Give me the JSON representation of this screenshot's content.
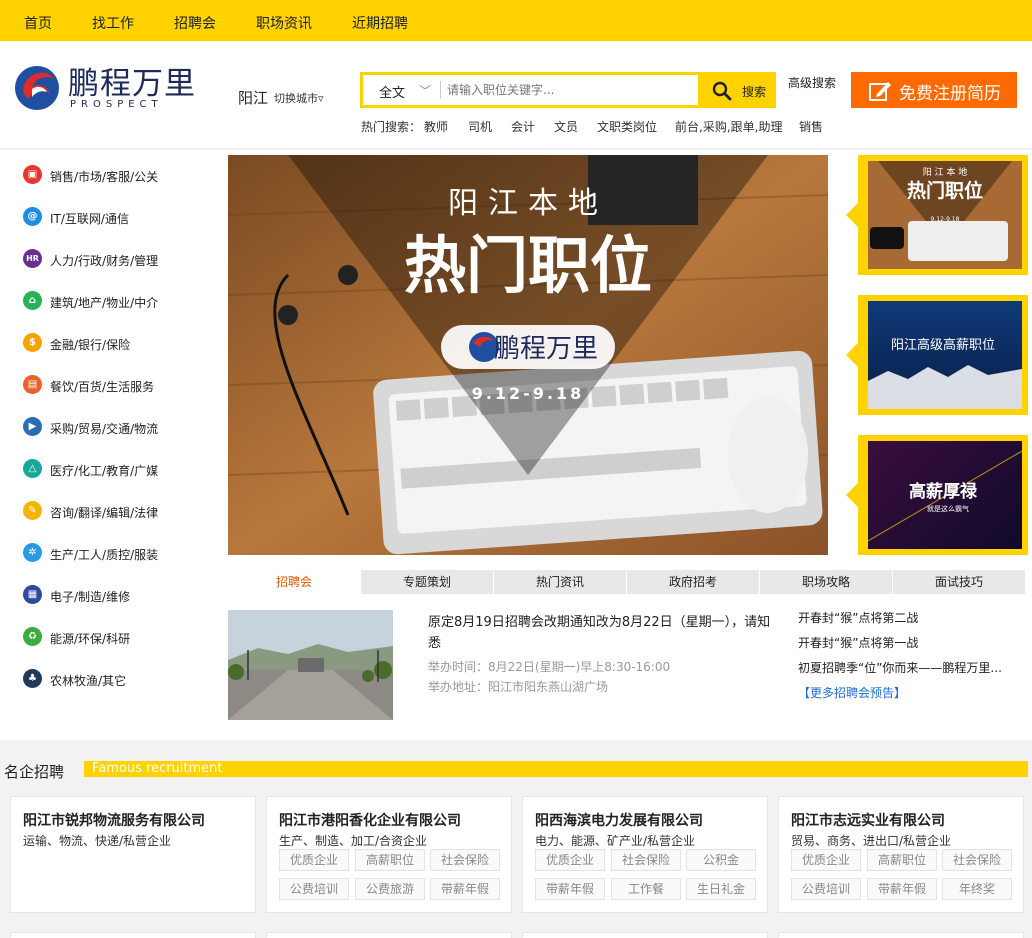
{
  "topnav": {
    "items": [
      "首页",
      "找工作",
      "招聘会",
      "职场资讯",
      "近期招聘"
    ]
  },
  "logo": {
    "cn": "鹏程万里",
    "en": "PROSPECT"
  },
  "city": {
    "name": "阳江",
    "switch_label": "切换城市▿"
  },
  "search": {
    "type": "全文",
    "placeholder": "请输入职位关键字...",
    "button_label": "搜索",
    "advanced_label": "高级搜索"
  },
  "register": {
    "label": "免费注册简历"
  },
  "hot": {
    "label": "热门搜索：",
    "keywords": [
      "教师",
      "司机",
      "会计",
      "文员",
      "文职类岗位",
      "前台,采购,跟单,助理",
      "销售"
    ]
  },
  "categories": [
    {
      "label": "销售/市场/客服/公关",
      "icon": "shopping-bag-icon",
      "color": "#e8352e"
    },
    {
      "label": "IT/互联网/通信",
      "icon": "at-icon",
      "color": "#1e8ee0"
    },
    {
      "label": "人力/行政/财务/管理",
      "icon": "hr-icon",
      "color": "#6a2f8f"
    },
    {
      "label": "建筑/地产/物业/中介",
      "icon": "house-icon",
      "color": "#2bb05a"
    },
    {
      "label": "金融/银行/保险",
      "icon": "dollar-icon",
      "color": "#f4a300"
    },
    {
      "label": "餐饮/百货/生活服务",
      "icon": "cart-icon",
      "color": "#e8622b"
    },
    {
      "label": "采购/贸易/交通/物流",
      "icon": "truck-icon",
      "color": "#2a6fb3"
    },
    {
      "label": "医疗/化工/教育/广媒",
      "icon": "flask-icon",
      "color": "#18a89a"
    },
    {
      "label": "咨询/翻译/编辑/法律",
      "icon": "edit-icon",
      "color": "#f2b600"
    },
    {
      "label": "生产/工人/质控/服装",
      "icon": "gear-icon",
      "color": "#2a9be0"
    },
    {
      "label": "电子/制造/维修",
      "icon": "chip-icon",
      "color": "#2d4aa0"
    },
    {
      "label": "能源/环保/科研",
      "icon": "recycle-icon",
      "color": "#3dab3d"
    },
    {
      "label": "农林牧渔/其它",
      "icon": "tree-icon",
      "color": "#1f3a5a"
    }
  ],
  "banner": {
    "line1": "阳江本地",
    "line2": "热门职位",
    "brand": "鹏程万里",
    "date": "9.12-9.18"
  },
  "thumbs": [
    {
      "top": "阳 江 本 地",
      "main": "热门职位",
      "date": "9.12-9.18"
    },
    {
      "main": "阳江高级高薪职位"
    },
    {
      "main": "高薪厚禄",
      "sub": "就是这么霸气"
    }
  ],
  "tabs": [
    "招聘会",
    "专题策划",
    "热门资讯",
    "政府招考",
    "职场攻略",
    "面试技巧"
  ],
  "news": {
    "title": "原定8月19日招聘会改期通知改为8月22日（星期一），请知悉",
    "time": "举办时间：8月22日(星期一)早上8:30-16:00",
    "place": "举办地址：阳江市阳东燕山湖广场",
    "links": [
      "开春封“猴”点将第二战",
      "开春封“猴”点将第一战",
      "初夏招聘季“位”你而来——鹏程万里..."
    ],
    "more": "【更多招聘会预告】"
  },
  "famous": {
    "title": "名企招聘",
    "en": "Famous recruitment"
  },
  "companies": [
    {
      "name": "阳江市锐邦物流服务有限公司",
      "industry": "运输、物流、快递/私营企业",
      "tags": []
    },
    {
      "name": "阳江市港阳香化企业有限公司",
      "industry": "生产、制造、加工/合资企业",
      "tags": [
        "优质企业",
        "高薪职位",
        "社会保险",
        "公费培训",
        "公费旅游",
        "带薪年假"
      ]
    },
    {
      "name": "阳西海滨电力发展有限公司",
      "industry": "电力、能源、矿产业/私营企业",
      "tags": [
        "优质企业",
        "社会保险",
        "公积金",
        "带薪年假",
        "工作餐",
        "生日礼金"
      ]
    },
    {
      "name": "阳江市志远实业有限公司",
      "industry": "贸易、商务、进出口/私营企业",
      "tags": [
        "优质企业",
        "高薪职位",
        "社会保险",
        "公费培训",
        "带薪年假",
        "年终奖"
      ]
    }
  ]
}
